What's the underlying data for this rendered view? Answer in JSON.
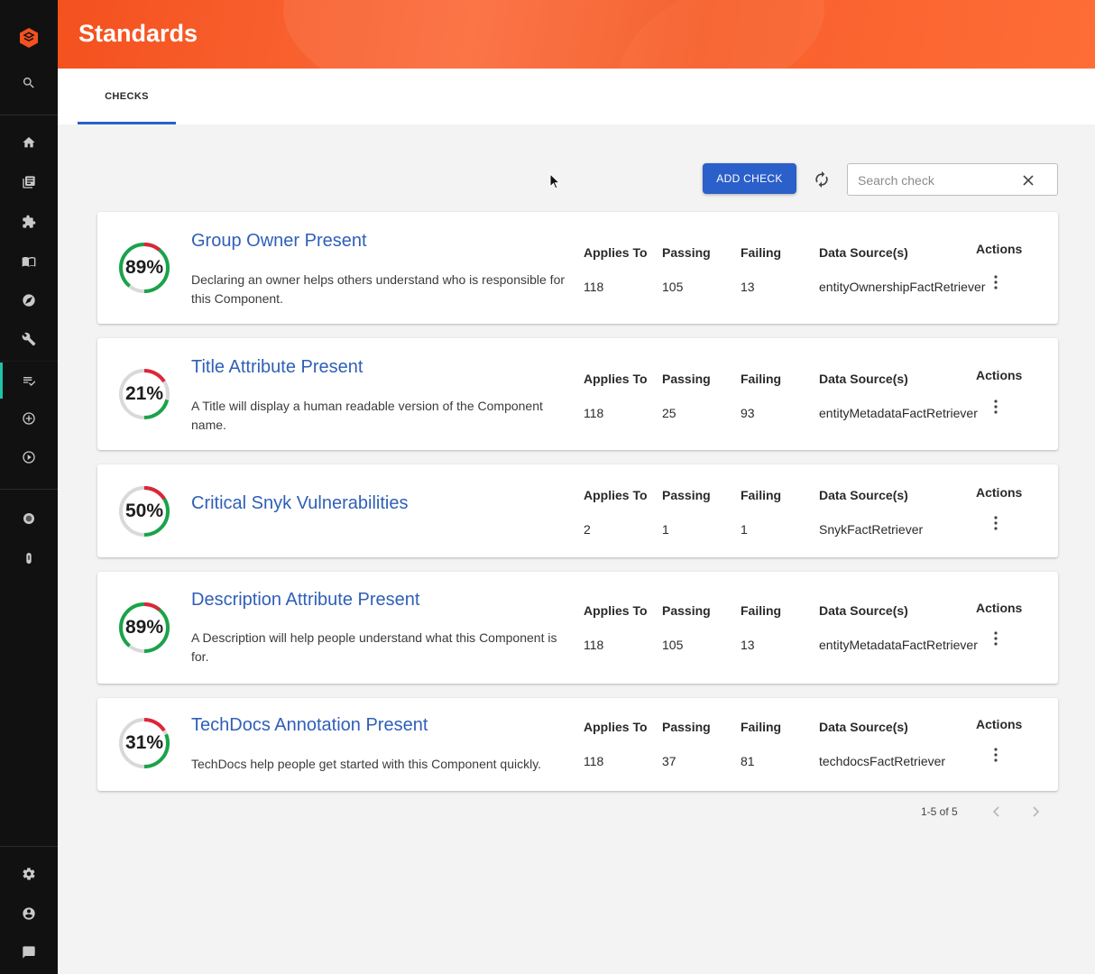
{
  "header": {
    "title": "Standards"
  },
  "tabs": [
    {
      "label": "CHECKS"
    }
  ],
  "toolbar": {
    "add_label": "ADD CHECK",
    "search_placeholder": "Search check"
  },
  "columns": {
    "applies_to": "Applies To",
    "passing": "Passing",
    "failing": "Failing",
    "data_sources": "Data Source(s)",
    "actions": "Actions"
  },
  "checks": [
    {
      "title": "Group Owner Present",
      "description": "Declaring an owner helps others understand who is responsible for this Component.",
      "percent_label": "89%",
      "percent": 89,
      "applies_to": "118",
      "passing": "105",
      "failing": "13",
      "data_source": "entityOwnershipFactRetriever"
    },
    {
      "title": "Title Attribute Present",
      "description": "A Title will display a human readable version of the Component name.",
      "percent_label": "21%",
      "percent": 21,
      "applies_to": "118",
      "passing": "25",
      "failing": "93",
      "data_source": "entityMetadataFactRetriever"
    },
    {
      "title": "Critical Snyk Vulnerabilities",
      "description": "",
      "percent_label": "50%",
      "percent": 50,
      "applies_to": "2",
      "passing": "1",
      "failing": "1",
      "data_source": "SnykFactRetriever"
    },
    {
      "title": "Description Attribute Present",
      "description": "A Description will help people understand what this Component is for.",
      "percent_label": "89%",
      "percent": 89,
      "applies_to": "118",
      "passing": "105",
      "failing": "13",
      "data_source": "entityMetadataFactRetriever"
    },
    {
      "title": "TechDocs Annotation Present",
      "description": "TechDocs help people get started with this Component quickly.",
      "percent_label": "31%",
      "percent": 31,
      "applies_to": "118",
      "passing": "37",
      "failing": "81",
      "data_source": "techdocsFactRetriever"
    }
  ],
  "pagination": {
    "range": "1-5 of 5"
  },
  "colors": {
    "pass": "#1aa34a",
    "fail": "#e0243a",
    "track": "#d9d9d9",
    "accent": "#2b5fc9",
    "header": "#f4511e",
    "sidebar": "#111111"
  },
  "sidebar_icons": [
    "logo-icon",
    "search-icon",
    "home-icon",
    "catalog-icon",
    "plugin-icon",
    "docs-icon",
    "explore-icon",
    "tools-icon",
    "standards-icon",
    "create-icon",
    "play-icon",
    "globe-icon",
    "pin-icon",
    "settings-icon",
    "profile-icon",
    "chat-icon"
  ]
}
